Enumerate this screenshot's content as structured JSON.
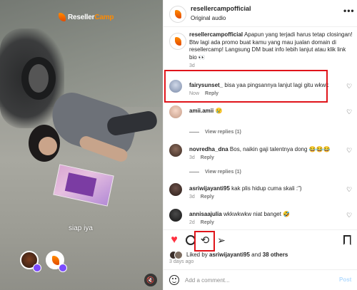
{
  "media": {
    "logo_main": "Reseller",
    "logo_alt": "Camp",
    "caption": "siap iya",
    "mute_icon": "speaker-muted-icon"
  },
  "header": {
    "username": "resellercampofficial",
    "audio": "Original audio",
    "more_label": "•••"
  },
  "caption": {
    "username": "resellercampofficial",
    "text": "Apapun yang terjadi harus tetap closingan! Btw lagi ada promo buat kamu yang mau jualan domain di resellercamp! Langsung DM buat info lebih lanjut atau klik link bio 👀",
    "time": "3d"
  },
  "comments": [
    {
      "username": "fairysunset_",
      "text": "bisa yaa pingsannya lanjut lagi gitu wkwk",
      "time": "Now",
      "reply": "Reply",
      "view_replies": ""
    },
    {
      "username": "amii.amii",
      "text": "😢",
      "time": "",
      "reply": "",
      "view_replies": "View replies (1)"
    },
    {
      "username": "novredha_dna",
      "text": "Bos, naikin gaji talentnya dong 😂😂😂",
      "time": "3d",
      "reply": "Reply",
      "view_replies": "View replies (1)"
    },
    {
      "username": "asriwijayanti95",
      "text": "kak plis hidup cuma skali :\")",
      "time": "3d",
      "reply": "Reply",
      "view_replies": ""
    },
    {
      "username": "annisaajulia",
      "text": "wkkwkwkw niat banget 🤣",
      "time": "2d",
      "reply": "Reply",
      "view_replies": ""
    }
  ],
  "liked": {
    "prefix": "Liked by ",
    "user": "asriwijayanti95",
    "middle": " and ",
    "others": "38 others"
  },
  "ago": "3 days ago",
  "add_comment": {
    "placeholder": "Add a comment...",
    "post": "Post"
  },
  "colors": {
    "highlight": "#e0141a",
    "like": "#ff3040",
    "brand": "#ff8a00",
    "post_disabled": "#b3dbff"
  }
}
